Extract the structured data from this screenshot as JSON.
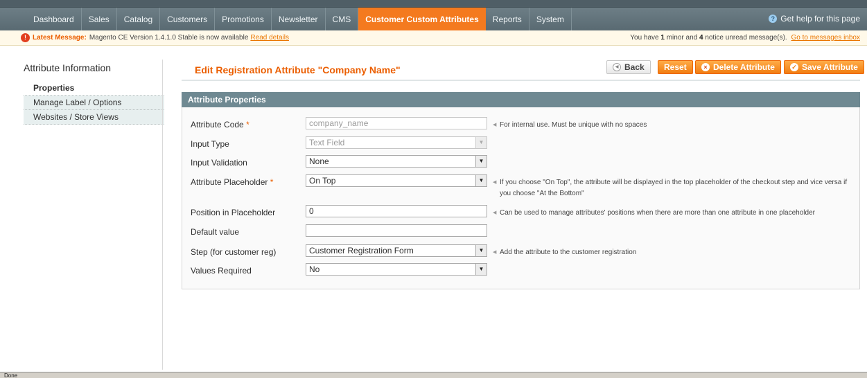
{
  "nav": {
    "items": [
      "Dashboard",
      "Sales",
      "Catalog",
      "Customers",
      "Promotions",
      "Newsletter",
      "CMS",
      "Customer Custom Attributes",
      "Reports",
      "System"
    ],
    "active_index": 7,
    "help_label": "Get help for this page",
    "help_icon": "help-circle-icon"
  },
  "message": {
    "icon": "error-icon",
    "strong": "Latest Message:",
    "text": "Magento CE Version 1.4.1.0 Stable is now available",
    "link": "Read details",
    "right_prefix": "You have",
    "minor_count": "1",
    "minor_text": "minor and",
    "notice_count": "4",
    "notice_text": "notice unread message(s).",
    "right_link": "Go to messages inbox"
  },
  "sidebar": {
    "title": "Attribute Information",
    "tabs": [
      "Properties",
      "Manage Label / Options",
      "Websites / Store Views"
    ],
    "active_index": 0
  },
  "header": {
    "title": "Edit Registration Attribute \"Company Name\"",
    "buttons": {
      "back": "Back",
      "reset": "Reset",
      "delete": "Delete Attribute",
      "save": "Save Attribute"
    }
  },
  "fieldset": {
    "title": "Attribute Properties",
    "fields": [
      {
        "label": "Attribute Code",
        "required": "*",
        "type": "text",
        "value": "company_name",
        "disabled": true,
        "note": "For internal use. Must be unique with no spaces"
      },
      {
        "label": "Input Type",
        "required": "",
        "type": "select",
        "value": "Text Field",
        "disabled": true,
        "note": ""
      },
      {
        "label": "Input Validation",
        "required": "",
        "type": "select",
        "value": "None",
        "disabled": false,
        "note": ""
      },
      {
        "label": "Attribute Placeholder",
        "required": "*",
        "type": "select",
        "value": "On Top",
        "disabled": false,
        "note": "If you choose \"On Top\", the attribute will be displayed in the top placeholder of the checkout step and vice versa if you choose \"At the Bottom\""
      },
      {
        "label": "Position in Placeholder",
        "required": "",
        "type": "text",
        "value": "0",
        "disabled": false,
        "note": "Can be used to manage attributes' positions when there are more than one attribute in one placeholder"
      },
      {
        "label": "Default value",
        "required": "",
        "type": "text",
        "value": "",
        "disabled": false,
        "note": ""
      },
      {
        "label": "Step (for customer reg)",
        "required": "",
        "type": "select",
        "value": "Customer Registration Form",
        "disabled": false,
        "note": "Add the attribute to the customer registration"
      },
      {
        "label": "Values Required",
        "required": "",
        "type": "select",
        "value": "No",
        "disabled": false,
        "note": ""
      }
    ]
  },
  "statusbar": {
    "text": "Done"
  }
}
